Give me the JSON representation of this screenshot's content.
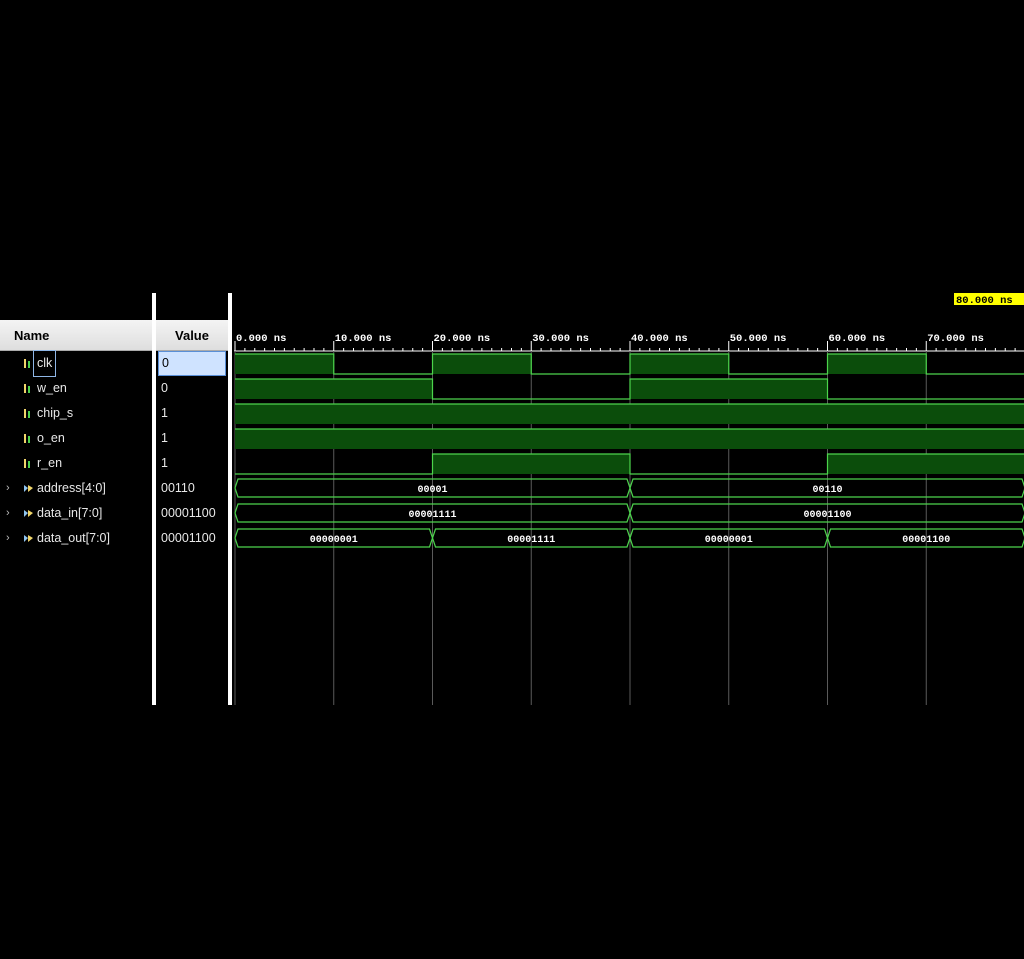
{
  "headers": {
    "name": "Name",
    "value": "Value"
  },
  "cursor_label": "80.000 ns",
  "time_ticks": [
    "0.000 ns",
    "10.000 ns",
    "20.000 ns",
    "30.000 ns",
    "40.000 ns",
    "50.000 ns",
    "60.000 ns",
    "70.000 ns"
  ],
  "colors": {
    "wave": "#4cd44c",
    "wave_fill": "#0b4d0b",
    "grid": "#5a5a5a",
    "cursor_bg": "#ffff00"
  },
  "signals": [
    {
      "name": "clk",
      "value": "0",
      "type": "bit",
      "icon": "bit-signal-icon",
      "selected": true,
      "high": [
        [
          0,
          10
        ],
        [
          20,
          30
        ],
        [
          40,
          50
        ],
        [
          60,
          70
        ]
      ]
    },
    {
      "name": "w_en",
      "value": "0",
      "type": "bit",
      "icon": "bit-signal-icon",
      "high": [
        [
          0,
          20
        ],
        [
          40,
          60
        ]
      ]
    },
    {
      "name": "chip_s",
      "value": "1",
      "type": "bit",
      "icon": "bit-signal-icon",
      "high": [
        [
          0,
          80
        ]
      ]
    },
    {
      "name": "o_en",
      "value": "1",
      "type": "bit",
      "icon": "bit-signal-icon",
      "high": [
        [
          0,
          80
        ]
      ]
    },
    {
      "name": "r_en",
      "value": "1",
      "type": "bit",
      "icon": "bit-signal-icon",
      "high": [
        [
          20,
          40
        ],
        [
          60,
          80
        ]
      ]
    },
    {
      "name": "address[4:0]",
      "value": "00110",
      "type": "bus",
      "icon": "bus-signal-icon",
      "segments": [
        {
          "start": 0,
          "end": 40,
          "label": "00001"
        },
        {
          "start": 40,
          "end": 80,
          "label": "00110"
        }
      ]
    },
    {
      "name": "data_in[7:0]",
      "value": "00001100",
      "type": "bus",
      "icon": "bus-signal-icon",
      "segments": [
        {
          "start": 0,
          "end": 40,
          "label": "00001111"
        },
        {
          "start": 40,
          "end": 80,
          "label": "00001100"
        }
      ]
    },
    {
      "name": "data_out[7:0]",
      "value": "00001100",
      "type": "bus",
      "icon": "bus-signal-icon",
      "segments": [
        {
          "start": 0,
          "end": 20,
          "label": "00000001"
        },
        {
          "start": 20,
          "end": 40,
          "label": "00001111"
        },
        {
          "start": 40,
          "end": 60,
          "label": "00000001"
        },
        {
          "start": 60,
          "end": 80,
          "label": "00001100"
        }
      ]
    }
  ]
}
